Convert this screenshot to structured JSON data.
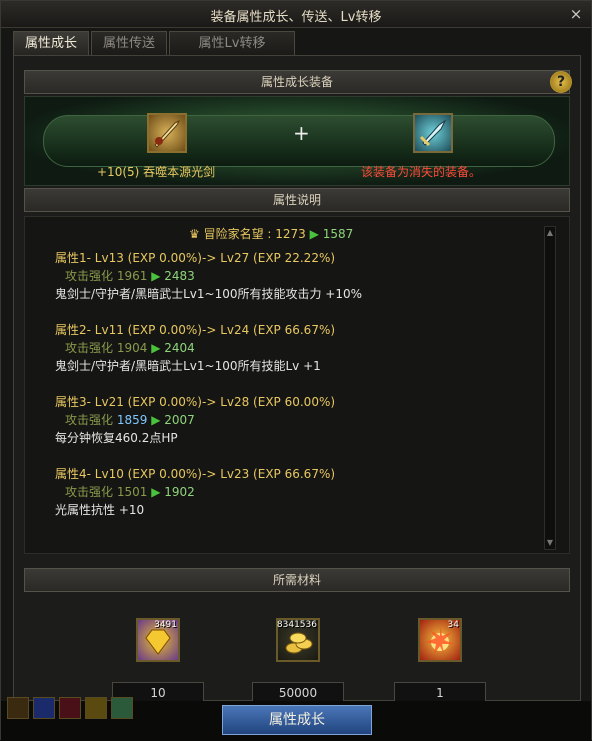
{
  "window": {
    "title": "装备属性成长、传送、Lv转移",
    "close_label": "×"
  },
  "tabs": [
    {
      "label": "属性成长"
    },
    {
      "label": "属性传送"
    },
    {
      "label": "属性Lv转移"
    }
  ],
  "equip_section": {
    "title": "属性成长装备",
    "help_label": "?",
    "plus": "+",
    "left_item_name": "+10(5) 吞噬本源光剑",
    "right_item_name": "该装备为消失的装备。"
  },
  "desc_section": {
    "title": "属性说明",
    "fame": {
      "label": "冒险家名望 : 1273",
      "new": "1587"
    },
    "attrs": [
      {
        "head": "属性1- Lv13 (EXP 0.00%)-> Lv27 (EXP 22.22%)",
        "enh_label": "攻击强化",
        "enh_old": "1961",
        "enh_new": "2483",
        "effect": "鬼剑士/守护者/黑暗武士Lv1~100所有技能攻击力 +10%"
      },
      {
        "head": "属性2- Lv11 (EXP 0.00%)-> Lv24 (EXP 66.67%)",
        "enh_label": "攻击强化",
        "enh_old": "1904",
        "enh_new": "2404",
        "effect": "鬼剑士/守护者/黑暗武士Lv1~100所有技能Lv +1"
      },
      {
        "head": "属性3- Lv21 (EXP 0.00%)-> Lv28 (EXP 60.00%)",
        "enh_label": "攻击强化",
        "enh_old": "1859",
        "enh_new": "2007",
        "effect": "每分钟恢复460.2点HP"
      },
      {
        "head": "属性4- Lv10 (EXP 0.00%)-> Lv23 (EXP 66.67%)",
        "enh_label": "攻击强化",
        "enh_old": "1501",
        "enh_new": "1902",
        "effect": "光属性抗性 +10"
      }
    ]
  },
  "materials_section": {
    "title": "所需材料",
    "items": [
      {
        "icon": "gem-icon",
        "stock": "3491",
        "required": "10"
      },
      {
        "icon": "gold-coins-icon",
        "stock": "8341536",
        "required": "50000"
      },
      {
        "icon": "fire-crystal-icon",
        "stock": "34",
        "required": "1"
      }
    ]
  },
  "main_button": "属性成长",
  "arrow_glyph": "▶"
}
